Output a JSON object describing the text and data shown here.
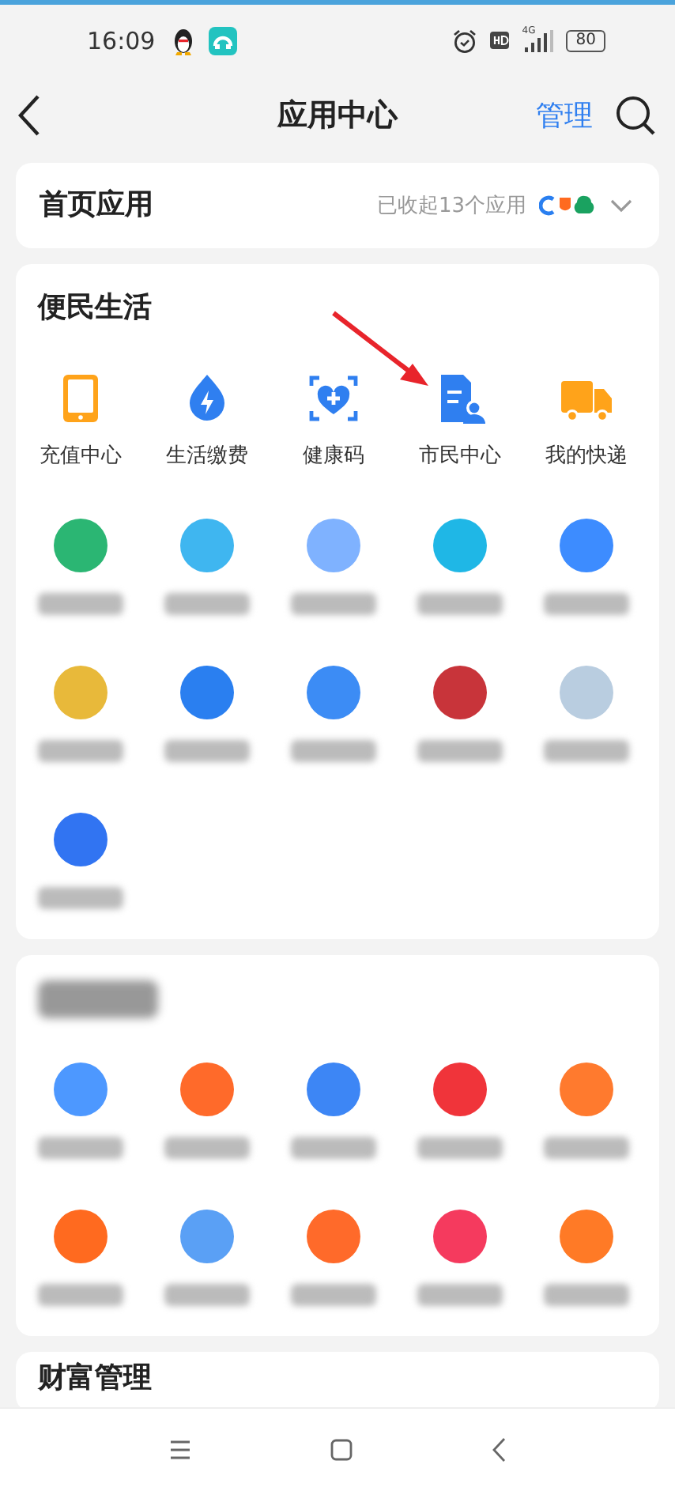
{
  "status_bar": {
    "time": "16:09",
    "network": "4G",
    "battery": "80"
  },
  "header": {
    "title": "应用中心",
    "action": "管理"
  },
  "home_apps": {
    "title": "首页应用",
    "summary": "已收起13个应用",
    "expanded": false
  },
  "sections": [
    {
      "kind": "clear",
      "title": "便民生活",
      "apps": [
        {
          "kind": "clear",
          "label": "充值中心"
        },
        {
          "kind": "clear",
          "label": "生活缴费"
        },
        {
          "kind": "clear",
          "label": "健康码"
        },
        {
          "kind": "clear",
          "label": "市民中心"
        },
        {
          "kind": "clear",
          "label": "我的快递"
        },
        {
          "kind": "blurred",
          "color": "#2bb673"
        },
        {
          "kind": "blurred",
          "color": "#3fb6f0"
        },
        {
          "kind": "blurred",
          "color": "#7fb2ff"
        },
        {
          "kind": "blurred",
          "color": "#1fb7e6"
        },
        {
          "kind": "blurred",
          "color": "#3d8cff"
        },
        {
          "kind": "blurred",
          "color": "#e8b93a"
        },
        {
          "kind": "blurred",
          "color": "#2a7ff0"
        },
        {
          "kind": "blurred",
          "color": "#3c8cf5"
        },
        {
          "kind": "blurred",
          "color": "#c8343a"
        },
        {
          "kind": "blurred",
          "color": "#b9cde0"
        },
        {
          "kind": "blurred",
          "color": "#3174f2"
        }
      ]
    },
    {
      "kind": "blurred",
      "apps": [
        {
          "kind": "blurred",
          "color": "#4d98ff"
        },
        {
          "kind": "blurred",
          "color": "#ff6a2a"
        },
        {
          "kind": "blurred",
          "color": "#3d86f5"
        },
        {
          "kind": "blurred",
          "color": "#f0343a"
        },
        {
          "kind": "blurred",
          "color": "#ff7a2e"
        },
        {
          "kind": "blurred",
          "color": "#ff6a1f"
        },
        {
          "kind": "blurred",
          "color": "#5aa0f5"
        },
        {
          "kind": "blurred",
          "color": "#ff6a2a"
        },
        {
          "kind": "blurred",
          "color": "#f53a5e"
        },
        {
          "kind": "blurred",
          "color": "#ff7a26"
        }
      ]
    },
    {
      "kind": "clear",
      "title": "财富管理"
    }
  ]
}
